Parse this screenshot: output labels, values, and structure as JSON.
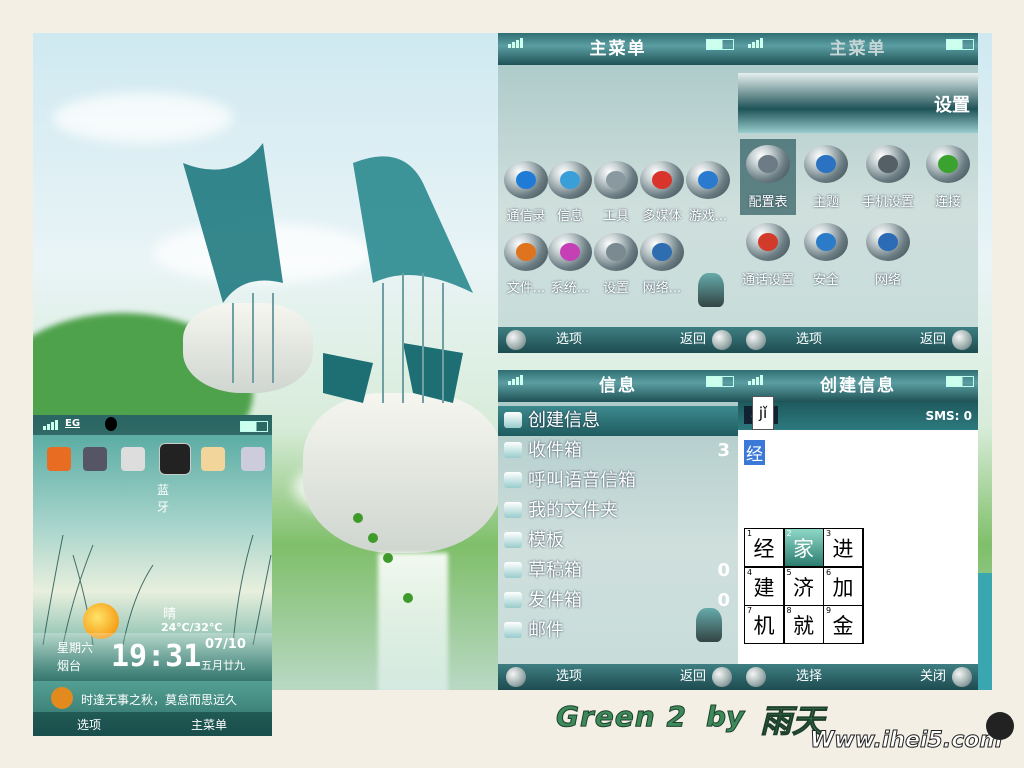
{
  "theme": {
    "accent": "#2f6f74",
    "text": "#ffffff",
    "highlight": "#3b78d8"
  },
  "main_menu": {
    "title": "主菜单",
    "items": [
      {
        "label": "通信录",
        "icon": "contacts-icon",
        "color": "#1f7bd6"
      },
      {
        "label": "信息",
        "icon": "messages-icon",
        "color": "#3a9fd9"
      },
      {
        "label": "工具",
        "icon": "tools-icon",
        "color": "#8a99a0"
      },
      {
        "label": "多媒体",
        "icon": "media-icon",
        "color": "#d9342b"
      },
      {
        "label": "游戏...",
        "icon": "games-icon",
        "color": "#2a7bd0"
      },
      {
        "label": "文件...",
        "icon": "files-icon",
        "color": "#e0731d"
      },
      {
        "label": "系统...",
        "icon": "system-icon",
        "color": "#c640b5"
      },
      {
        "label": "设置",
        "icon": "settings-icon",
        "color": "#7a8a90"
      },
      {
        "label": "网络...",
        "icon": "network-icon",
        "color": "#2d6db0"
      }
    ],
    "soft_left": "选项",
    "soft_right": "返回"
  },
  "settings_menu": {
    "title": "主菜单",
    "heading": "设置",
    "items": [
      {
        "label": "配置表",
        "icon": "profiles-icon",
        "color": "#6c7b85"
      },
      {
        "label": "主题",
        "icon": "themes-icon",
        "color": "#2b73c2"
      },
      {
        "label": "手机设置",
        "icon": "phone-settings-icon",
        "color": "#555f66"
      },
      {
        "label": "连接",
        "icon": "connectivity-icon",
        "color": "#3aa32f"
      },
      {
        "label": "通话设置",
        "icon": "call-settings-icon",
        "color": "#d23a2a"
      },
      {
        "label": "安全",
        "icon": "security-icon",
        "color": "#2b7bc8"
      },
      {
        "label": "网络",
        "icon": "globe-icon",
        "color": "#2b6ab5"
      }
    ],
    "soft_left": "选项",
    "soft_right": "返回"
  },
  "messages": {
    "title": "信息",
    "items": [
      {
        "label": "创建信息",
        "count": ""
      },
      {
        "label": "收件箱",
        "count": "3"
      },
      {
        "label": "呼叫语音信箱",
        "count": ""
      },
      {
        "label": "我的文件夹",
        "count": ""
      },
      {
        "label": "模板",
        "count": ""
      },
      {
        "label": "草稿箱",
        "count": "0"
      },
      {
        "label": "发件箱",
        "count": "0"
      },
      {
        "label": "邮件",
        "count": ""
      }
    ],
    "soft_left": "选项",
    "soft_right": "返回"
  },
  "create_message": {
    "title": "创建信息",
    "mode": "jǐ",
    "sms_counter": "SMS: 0",
    "input_text": "经",
    "candidates": [
      {
        "n": "1",
        "c": "经"
      },
      {
        "n": "2",
        "c": "家"
      },
      {
        "n": "3",
        "c": "进"
      },
      {
        "n": "4",
        "c": "建"
      },
      {
        "n": "5",
        "c": "济"
      },
      {
        "n": "6",
        "c": "加"
      },
      {
        "n": "7",
        "c": "机"
      },
      {
        "n": "8",
        "c": "就"
      },
      {
        "n": "9",
        "c": "金"
      }
    ],
    "soft_left": "选择",
    "soft_right": "关闭"
  },
  "standby": {
    "network": "EG",
    "focused_shortcut": "蓝牙",
    "weather": "晴",
    "temperature": "24℃/32℃",
    "weekday": "星期六",
    "city": "烟台",
    "time": "19:31",
    "date": "07/10",
    "lunar": "五月廿九",
    "ticker": "时逢无事之秋，莫怠而思远久",
    "soft_left": "选项",
    "soft_right": "主菜单"
  },
  "watermark": {
    "title": "Green 2",
    "by": "by",
    "author": "雨天",
    "url": "Www.ihei5.com"
  }
}
